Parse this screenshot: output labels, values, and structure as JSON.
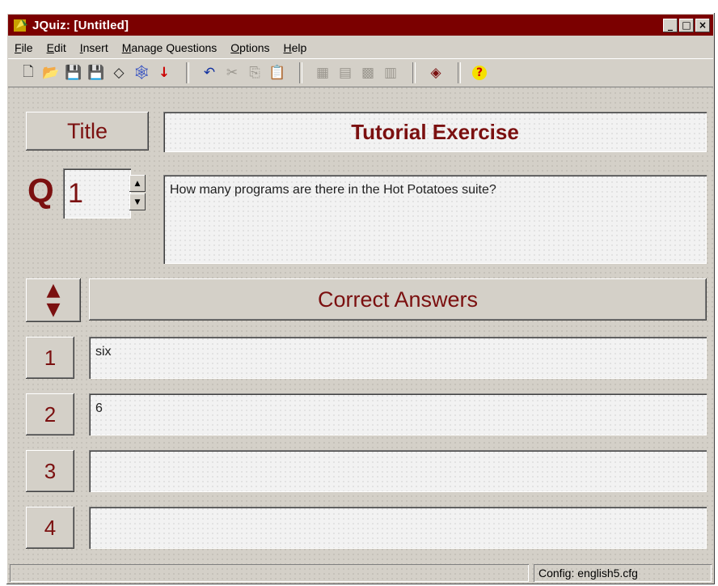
{
  "window": {
    "title": "JQuiz: [Untitled]",
    "controls": [
      "_",
      "□",
      "×"
    ]
  },
  "menu": [
    "File",
    "Edit",
    "Insert",
    "Manage Questions",
    "Options",
    "Help"
  ],
  "toolbar": [
    {
      "icon": "new-file-icon",
      "glyph": "🗋"
    },
    {
      "icon": "open-folder-icon",
      "glyph": "📂"
    },
    {
      "icon": "save-icon",
      "glyph": "💾"
    },
    {
      "icon": "save-as-icon",
      "glyph": "💾"
    },
    {
      "icon": "clear-icon",
      "glyph": "◇"
    },
    {
      "icon": "web-page-icon",
      "glyph": "🕸"
    },
    {
      "icon": "export-arrow-icon",
      "glyph": "↓"
    },
    {
      "icon": "undo-icon",
      "glyph": "↶"
    },
    {
      "icon": "cut-icon",
      "glyph": "✂"
    },
    {
      "icon": "copy-icon",
      "glyph": "⎘"
    },
    {
      "icon": "paste-icon",
      "glyph": "📋"
    },
    {
      "icon": "tool-a-icon",
      "glyph": "▦"
    },
    {
      "icon": "tool-b-icon",
      "glyph": "▤"
    },
    {
      "icon": "tool-c-icon",
      "glyph": "▩"
    },
    {
      "icon": "tool-d-icon",
      "glyph": "▥"
    },
    {
      "icon": "config-icon",
      "glyph": "◈"
    },
    {
      "icon": "help-icon",
      "glyph": "?"
    }
  ],
  "title_label": "Title",
  "exercise_title": "Tutorial Exercise",
  "question": {
    "letter": "Q",
    "number": "1",
    "text": "How many programs are there in the Hot Potatoes suite?"
  },
  "answers_header": "Correct Answers",
  "answers": [
    {
      "num": "1",
      "value": "six"
    },
    {
      "num": "2",
      "value": "6"
    },
    {
      "num": "3",
      "value": ""
    },
    {
      "num": "4",
      "value": ""
    }
  ],
  "status": {
    "left": "",
    "config": "Config: english5.cfg"
  }
}
